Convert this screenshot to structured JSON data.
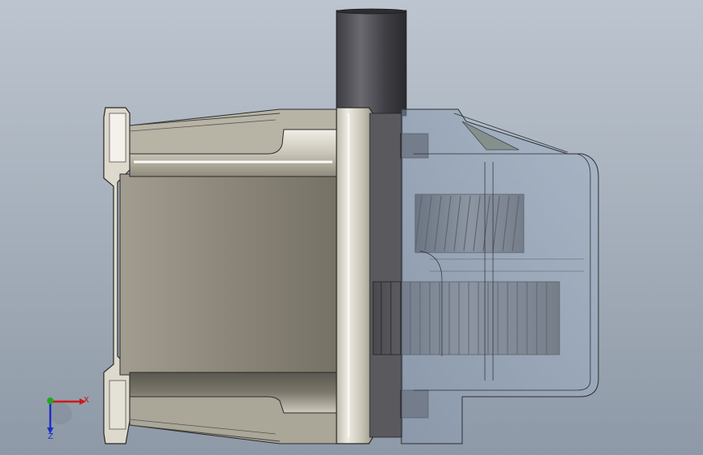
{
  "viewport": {
    "background_top": "#b7c0cb",
    "background_bottom": "#8d98a6"
  },
  "triad": {
    "x_label": "X",
    "z_label": "Z",
    "x_color": "#d01818",
    "y_color": "#1fa81f",
    "z_color": "#1c2fc4"
  },
  "model": {
    "housing_color": "#8c877a",
    "flange_color": "#d8d5c8",
    "shaft_color": "#4b4b50",
    "transparent_cover_color": "#9fb0c6"
  }
}
